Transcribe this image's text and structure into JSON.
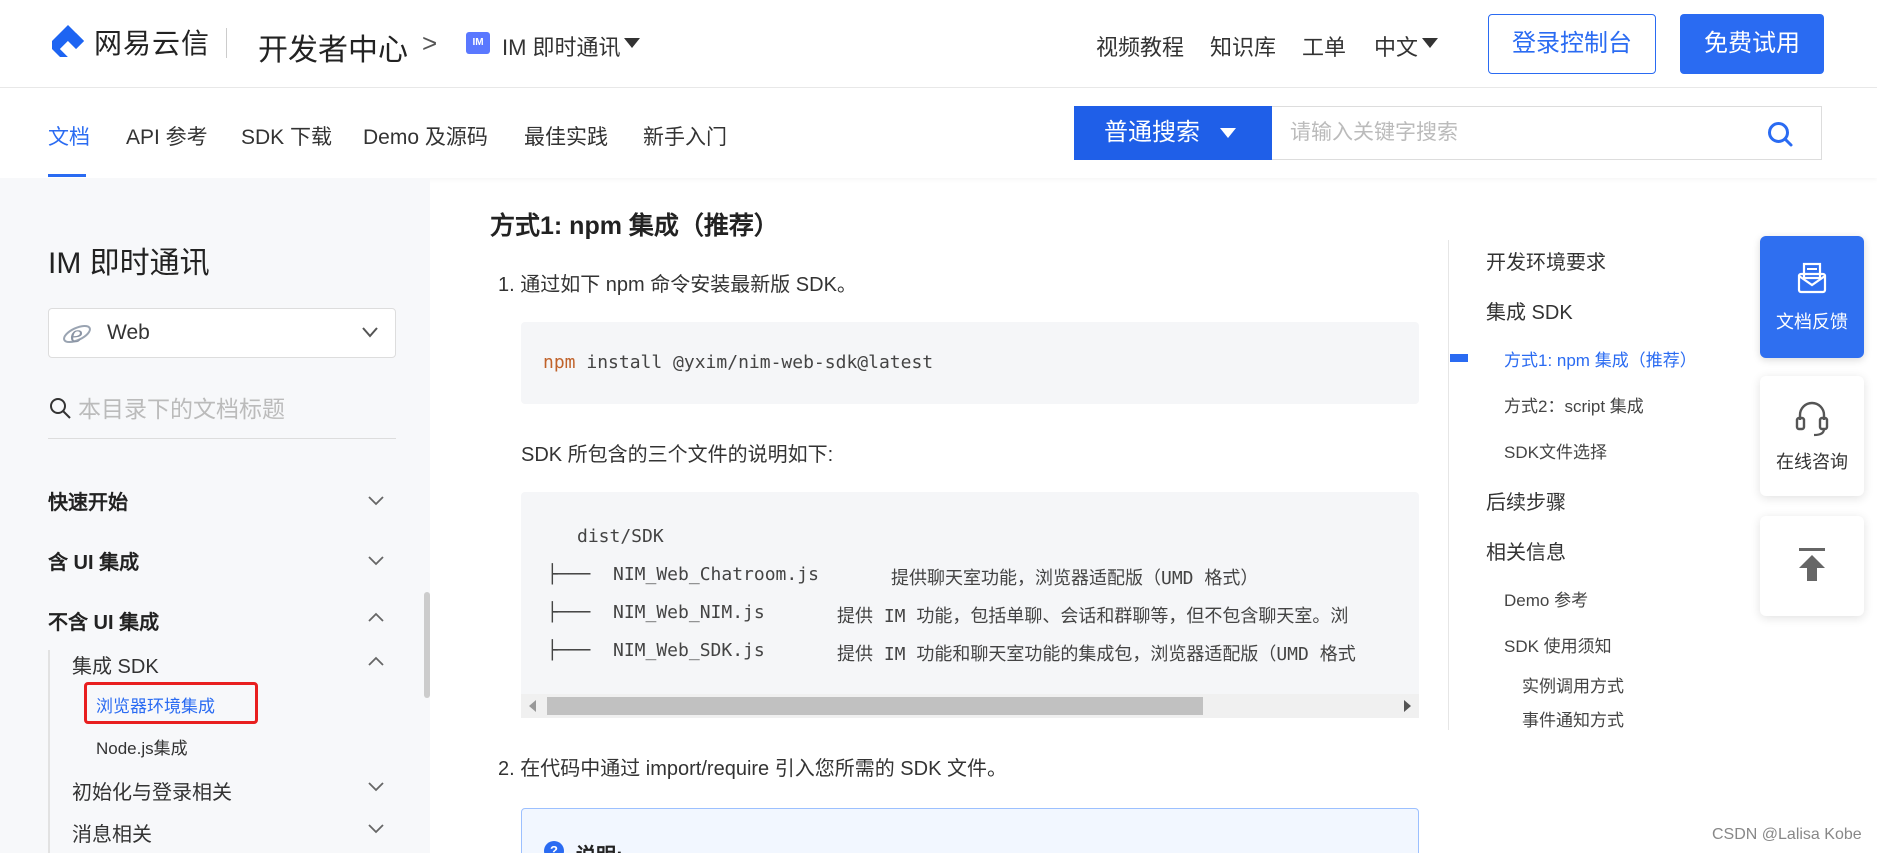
{
  "header": {
    "brand": "网易云信",
    "dev_center": "开发者中心",
    "breadcrumb_arrow": ">",
    "product_badge": "IM",
    "product": "IM 即时通讯",
    "nav": [
      "视频教程",
      "知识库",
      "工单",
      "中文"
    ],
    "console_button": "登录控制台",
    "trial_button": "免费试用",
    "accent_color": "#2a6bf2"
  },
  "subnav": {
    "items": [
      "文档",
      "API 参考",
      "SDK 下载",
      "Demo 及源码",
      "最佳实践",
      "新手入门"
    ],
    "active_index": 0,
    "search_type": "普通搜索",
    "search_placeholder": "请输入关键字搜索"
  },
  "sidebar": {
    "title": "IM 即时通讯",
    "platform": "Web",
    "dir_search_placeholder": "本目录下的文档标题",
    "tree": [
      {
        "label": "快速开始",
        "expanded": false
      },
      {
        "label": "含 UI 集成",
        "expanded": false
      },
      {
        "label": "不含 UI 集成",
        "expanded": true
      },
      {
        "label": "集成 SDK",
        "expanded": true
      },
      {
        "label": "浏览器环境集成",
        "active": true
      },
      {
        "label": "Node.js集成"
      },
      {
        "label": "初始化与登录相关",
        "expanded": false
      },
      {
        "label": "消息相关",
        "expanded": false
      }
    ]
  },
  "main": {
    "heading": "方式1: npm 集成（推荐）",
    "step1": "1. 通过如下 npm 命令安装最新版 SDK。",
    "npm_cmd_keyword": "npm",
    "npm_cmd_rest": " install @yxim/nim-web-sdk@latest",
    "files_intro": "SDK 所包含的三个文件的说明如下:",
    "tree_root": "dist/SDK",
    "files": [
      {
        "prefix": "├─── ",
        "name": "NIM_Web_Chatroom.js",
        "desc": "提供聊天室功能，浏览器适配版（UMD 格式）"
      },
      {
        "prefix": "├─── ",
        "name": "NIM_Web_NIM.js",
        "desc": "提供 IM 功能，包括单聊、会话和群聊等，但不包含聊天室。浏"
      },
      {
        "prefix": "├─── ",
        "name": "NIM_Web_SDK.js",
        "desc": "提供 IM 功能和聊天室功能的集成包，浏览器适配版（UMD 格式"
      }
    ],
    "step2": "2. 在代码中通过 import/require 引入您所需的 SDK 文件。",
    "note_icon": "?",
    "note_label": "说明:"
  },
  "toc": [
    {
      "label": "开发环境要求",
      "level": 1
    },
    {
      "label": "集成 SDK",
      "level": 1
    },
    {
      "label": "方式1: npm 集成（推荐）",
      "level": 2,
      "active": true
    },
    {
      "label": "方式2：script 集成",
      "level": 2
    },
    {
      "label": "SDK文件选择",
      "level": 2
    },
    {
      "label": "后续步骤",
      "level": 1
    },
    {
      "label": "相关信息",
      "level": 1
    },
    {
      "label": "Demo 参考",
      "level": 2
    },
    {
      "label": "SDK 使用须知",
      "level": 2
    },
    {
      "label": "实例调用方式",
      "level": 3
    },
    {
      "label": "事件通知方式",
      "level": 3
    }
  ],
  "floating": {
    "feedback": "文档反馈",
    "consult": "在线咨询",
    "back_to_top_icon": "arrow-up-to-top-icon"
  },
  "watermark": "CSDN @Lalisa Kobe"
}
